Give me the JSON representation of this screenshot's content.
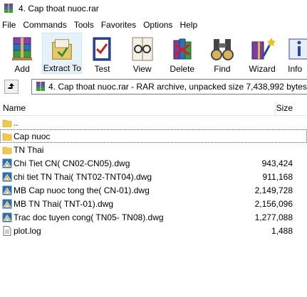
{
  "window": {
    "title": "4. Cap thoat nuoc.rar"
  },
  "menu": [
    "File",
    "Commands",
    "Tools",
    "Favorites",
    "Options",
    "Help"
  ],
  "toolbar": [
    {
      "label": "Add",
      "icon": "rar-stack-icon"
    },
    {
      "label": "Extract To",
      "icon": "extract-folder-icon"
    },
    {
      "label": "Test",
      "icon": "test-checklist-icon"
    },
    {
      "label": "View",
      "icon": "view-glasses-icon"
    },
    {
      "label": "Delete",
      "icon": "delete-books-icon"
    },
    {
      "label": "Find",
      "icon": "find-binoculars-icon"
    },
    {
      "label": "Wizard",
      "icon": "wizard-icon"
    },
    {
      "label": "Info",
      "icon": "info-icon"
    }
  ],
  "address": {
    "path": "4. Cap thoat nuoc.rar - RAR archive, unpacked size 7,438,992 bytes"
  },
  "columns": {
    "name": "Name",
    "size": "Size"
  },
  "files": [
    {
      "name": "..",
      "size": "",
      "type": "parent-folder"
    },
    {
      "name": "Cap nuoc",
      "size": "",
      "type": "folder"
    },
    {
      "name": "TN Thai",
      "size": "",
      "type": "folder"
    },
    {
      "name": "Chi Tiet CN( CN02-CN05).dwg",
      "size": "943,424",
      "type": "dwg"
    },
    {
      "name": "chi tiet TN Thai( TNT02-TNT04).dwg",
      "size": "911,168",
      "type": "dwg"
    },
    {
      "name": "MB Cap nuoc tong the( CN-01).dwg",
      "size": "2,149,728",
      "type": "dwg"
    },
    {
      "name": "MB TN Thai( TNT-01).dwg",
      "size": "2,156,096",
      "type": "dwg"
    },
    {
      "name": "Trac doc tuyen cong( TN05- TN08).dwg",
      "size": "1,277,088",
      "type": "dwg"
    },
    {
      "name": "plot.log",
      "size": "1,488",
      "type": "log"
    }
  ]
}
